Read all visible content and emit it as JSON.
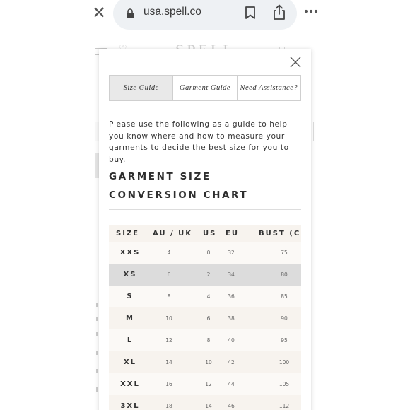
{
  "browser": {
    "close_icon": "close-icon",
    "url": "usa.spell.co",
    "icons": [
      "lock-icon",
      "bookmark-icon",
      "share-icon",
      "more-icon"
    ]
  },
  "site": {
    "logo": "SPELL"
  },
  "modal": {
    "tabs": [
      {
        "label": "Size Guide",
        "active": true
      },
      {
        "label": "Garment Guide",
        "active": false
      },
      {
        "label": "Need Assistance?",
        "active": false
      }
    ],
    "intro": "Please use the following as a guide to help you know where and how to measure your garments to decide the best size for you to buy.",
    "chart_title": "GARMENT SIZE CONVERSION CHART",
    "table": {
      "headers": {
        "size": "SIZE",
        "au_uk": "AU / UK",
        "us": "US",
        "eu": "EU",
        "bust": "BUST (CM"
      },
      "rows": [
        {
          "size": "XXS",
          "au_uk": "4",
          "us": "0",
          "eu": "32",
          "bust": "75"
        },
        {
          "size": "XS",
          "au_uk": "6",
          "us": "2",
          "eu": "34",
          "bust": "80"
        },
        {
          "size": "S",
          "au_uk": "8",
          "us": "4",
          "eu": "36",
          "bust": "85"
        },
        {
          "size": "M",
          "au_uk": "10",
          "us": "6",
          "eu": "38",
          "bust": "90"
        },
        {
          "size": "L",
          "au_uk": "12",
          "us": "8",
          "eu": "40",
          "bust": "95"
        },
        {
          "size": "XL",
          "au_uk": "14",
          "us": "10",
          "eu": "42",
          "bust": "100"
        },
        {
          "size": "XXL",
          "au_uk": "16",
          "us": "12",
          "eu": "44",
          "bust": "105"
        },
        {
          "size": "3XL",
          "au_uk": "18",
          "us": "14",
          "eu": "46",
          "bust": "112"
        }
      ],
      "highlighted_row": "XS"
    }
  },
  "colors": {
    "url_pill": "#eef1f4",
    "row_odd": "#f7f3ee",
    "row_even": "#fbf9f6",
    "row_selected": "#dcdcdc",
    "active_tab": "#e9e9e9"
  }
}
